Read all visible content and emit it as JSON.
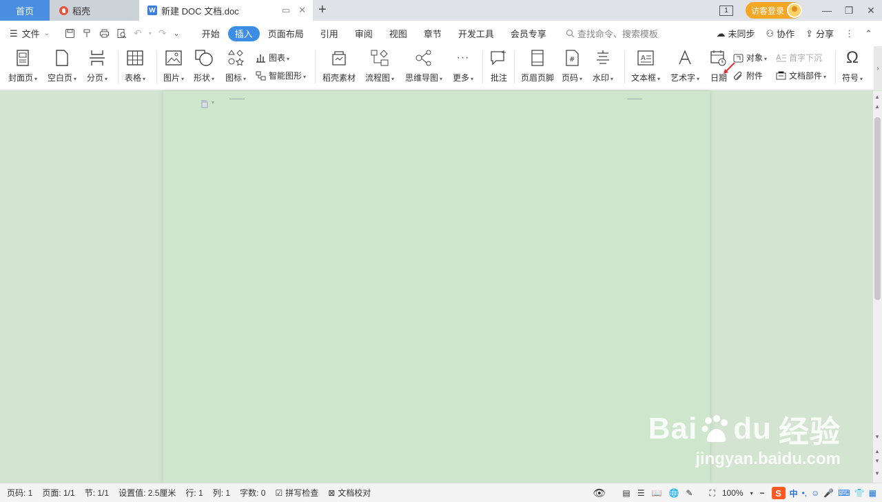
{
  "tabs": {
    "home": "首页",
    "doke": "稻壳",
    "doc": "新建 DOC 文档.doc"
  },
  "titlebar": {
    "page_indicator": "1",
    "login": "访客登录"
  },
  "menu": {
    "file": "文件",
    "tabs": [
      "开始",
      "插入",
      "页面布局",
      "引用",
      "审阅",
      "视图",
      "章节",
      "开发工具",
      "会员专享"
    ],
    "active_tab": "插入",
    "search": "查找命令、搜索模板",
    "sync": "未同步",
    "collab": "协作",
    "share": "分享"
  },
  "ribbon": {
    "cover": "封面页",
    "blank": "空白页",
    "pagebreak": "分页",
    "table": "表格",
    "picture": "图片",
    "shape": "形状",
    "icon": "图标",
    "chart": "图表",
    "smartart": "智能图形",
    "doke_material": "稻壳素材",
    "flowchart": "流程图",
    "mindmap": "思维导图",
    "more": "更多",
    "comment": "批注",
    "header_footer": "页眉页脚",
    "page_number": "页码",
    "watermark": "水印",
    "textbox": "文本框",
    "wordart": "艺术字",
    "date": "日期",
    "object": "对象",
    "dropcap": "首字下沉",
    "attachment": "附件",
    "doc_parts": "文档部件",
    "symbol": "符号"
  },
  "status": {
    "page_code": "页码: 1",
    "pages": "页面: 1/1",
    "section": "节: 1/1",
    "setting": "设置值: 2.5厘米",
    "row": "行: 1",
    "col": "列: 1",
    "words": "字数: 0",
    "spell": "拼写检查",
    "proof": "文档校对",
    "zoom": "100%"
  },
  "ime": {
    "lang": "中"
  },
  "watermark": {
    "brand": "Bai",
    "brand2": "du",
    "cn": "经验",
    "url": "jingyan.baidu.com"
  }
}
